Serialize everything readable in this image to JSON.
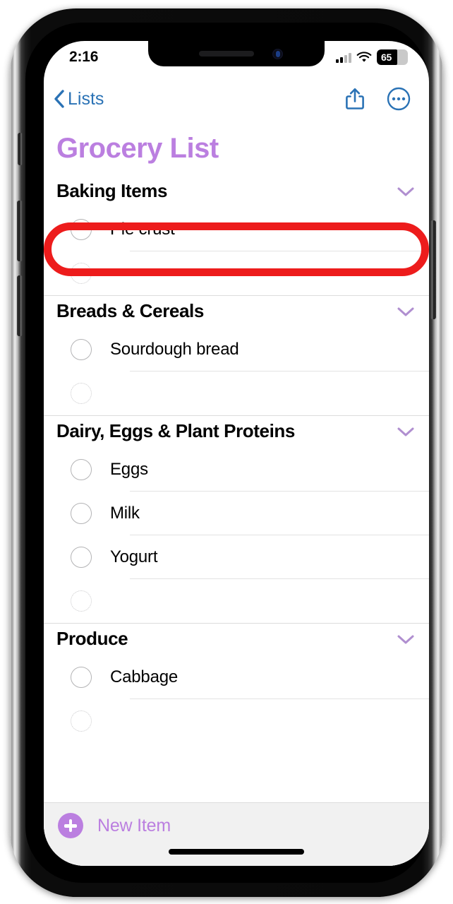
{
  "status_bar": {
    "time": "2:16",
    "battery_percent": "65",
    "battery_fill_ratio": 0.66,
    "cellular_icon": "cellular-bars-icon",
    "wifi_icon": "wifi-icon"
  },
  "nav": {
    "back_label": "Lists",
    "back_icon": "chevron-left-icon",
    "share_icon": "share-icon",
    "more_icon": "more-circle-icon",
    "accent_color": "#2a72b5"
  },
  "page": {
    "title": "Grocery List",
    "title_color": "#bb7fe0"
  },
  "sections": [
    {
      "title": "Baking Items",
      "collapse_icon": "chevron-down-icon",
      "items": [
        {
          "label": "Pie crust",
          "checked": false,
          "placeholder": false
        },
        {
          "label": "",
          "checked": false,
          "placeholder": true
        }
      ]
    },
    {
      "title": "Breads & Cereals",
      "collapse_icon": "chevron-down-icon",
      "items": [
        {
          "label": "Sourdough bread",
          "checked": false,
          "placeholder": false
        },
        {
          "label": "",
          "checked": false,
          "placeholder": true
        }
      ]
    },
    {
      "title": "Dairy, Eggs & Plant Proteins",
      "collapse_icon": "chevron-down-icon",
      "items": [
        {
          "label": "Eggs",
          "checked": false,
          "placeholder": false
        },
        {
          "label": "Milk",
          "checked": false,
          "placeholder": false
        },
        {
          "label": "Yogurt",
          "checked": false,
          "placeholder": false
        },
        {
          "label": "",
          "checked": false,
          "placeholder": true
        }
      ]
    },
    {
      "title": "Produce",
      "collapse_icon": "chevron-down-icon",
      "items": [
        {
          "label": "Cabbage",
          "checked": false,
          "placeholder": false
        },
        {
          "label": "",
          "checked": false,
          "placeholder": true
        }
      ]
    }
  ],
  "footer": {
    "new_item_label": "New Item",
    "new_item_icon": "plus-circle-icon",
    "accent_color": "#bb7fe0"
  },
  "annotation": {
    "type": "rounded-rectangle-highlight",
    "color": "#ed1c1c",
    "targets": "Pie crust"
  }
}
